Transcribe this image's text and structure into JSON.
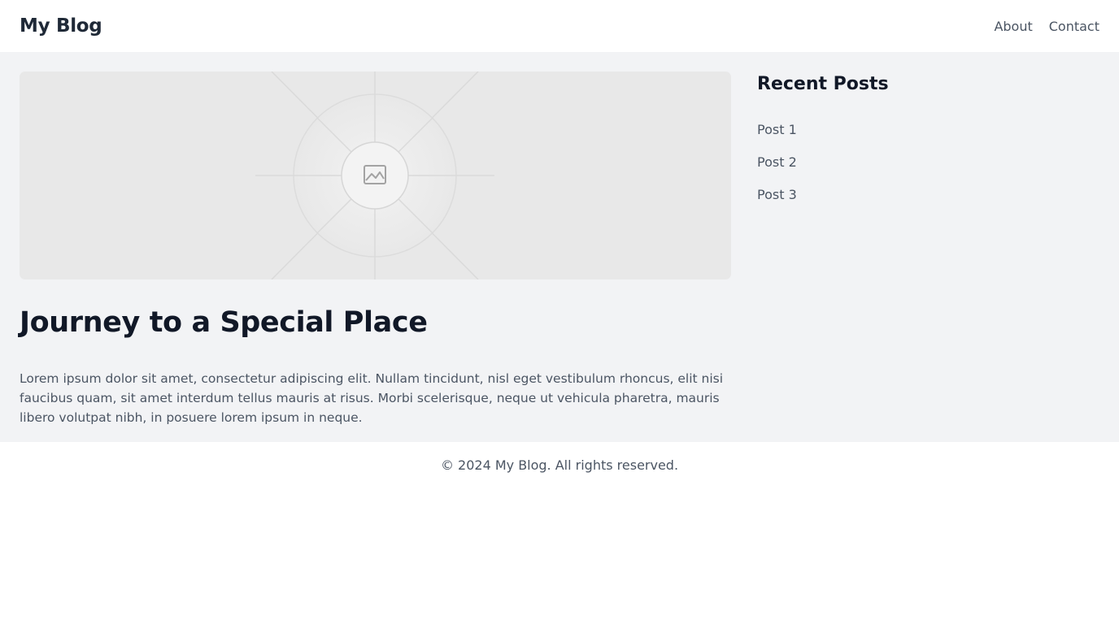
{
  "header": {
    "site_title": "My Blog",
    "nav": [
      {
        "label": "About"
      },
      {
        "label": "Contact"
      }
    ]
  },
  "main": {
    "hero_image": {
      "icon": "image-icon"
    },
    "post": {
      "title": "Journey to a Special Place",
      "body": "Lorem ipsum dolor sit amet, consectetur adipiscing elit. Nullam tincidunt, nisl eget vestibulum rhoncus, elit nisi faucibus quam, sit amet interdum tellus mauris at risus. Morbi scelerisque, neque ut vehicula pharetra, mauris libero volutpat nibh, in posuere lorem ipsum in neque."
    }
  },
  "sidebar": {
    "title": "Recent Posts",
    "items": [
      {
        "label": "Post 1"
      },
      {
        "label": "Post 2"
      },
      {
        "label": "Post 3"
      }
    ]
  },
  "footer": {
    "text": "© 2024 My Blog. All rights reserved."
  },
  "colors": {
    "page_background": "#f2f3f5",
    "header_background": "#ffffff",
    "heading_text": "#111827",
    "body_text": "#4b5563",
    "placeholder_background": "#e8e8e8"
  }
}
